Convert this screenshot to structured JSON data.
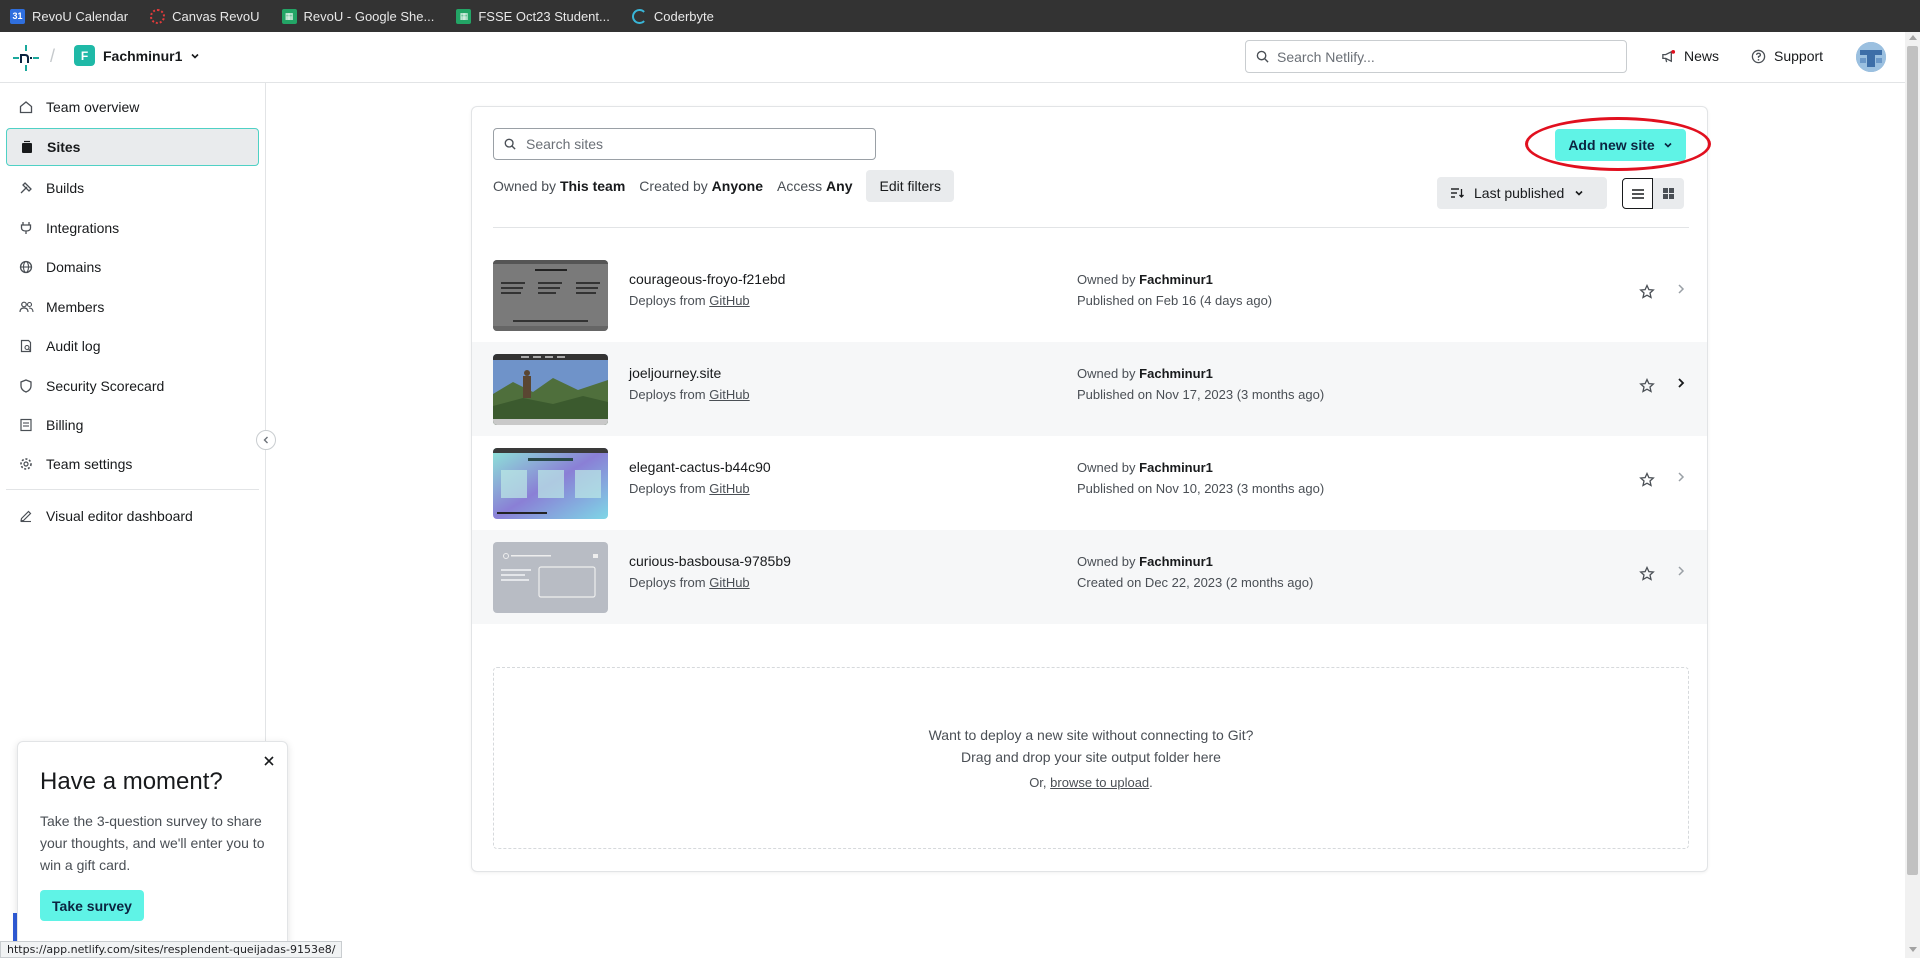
{
  "bookmarks": [
    {
      "label": "RevoU Calendar",
      "icon": "calendar-icon"
    },
    {
      "label": "Canvas RevoU",
      "icon": "canvas-icon"
    },
    {
      "label": "RevoU - Google She...",
      "icon": "sheets-icon"
    },
    {
      "label": "FSSE Oct23 Student...",
      "icon": "sheets-icon"
    },
    {
      "label": "Coderbyte",
      "icon": "coderbyte-icon"
    }
  ],
  "header": {
    "team_name": "Fachminur1",
    "team_initial": "F",
    "search_placeholder": "Search Netlify...",
    "news_label": "News",
    "support_label": "Support"
  },
  "sidebar": {
    "items": [
      {
        "label": "Team overview",
        "icon": "home-icon"
      },
      {
        "label": "Sites",
        "icon": "sites-icon"
      },
      {
        "label": "Builds",
        "icon": "builds-icon"
      },
      {
        "label": "Integrations",
        "icon": "plug-icon"
      },
      {
        "label": "Domains",
        "icon": "globe-icon"
      },
      {
        "label": "Members",
        "icon": "members-icon"
      },
      {
        "label": "Audit log",
        "icon": "audit-log-icon"
      },
      {
        "label": "Security Scorecard",
        "icon": "shield-icon"
      },
      {
        "label": "Billing",
        "icon": "billing-icon"
      },
      {
        "label": "Team settings",
        "icon": "gear-icon"
      },
      {
        "label": "Visual editor dashboard",
        "icon": "pencil-icon"
      }
    ]
  },
  "sites_panel": {
    "search_placeholder": "Search sites",
    "add_button": "Add new site",
    "filters": {
      "owned_by_label": "Owned by",
      "owned_by_value": "This team",
      "created_by_label": "Created by",
      "created_by_value": "Anyone",
      "access_label": "Access",
      "access_value": "Any",
      "edit_filters": "Edit filters"
    },
    "sort_label": "Last published",
    "sites": [
      {
        "name": "courageous-froyo-f21ebd",
        "deploy_prefix": "Deploys from",
        "deploy_source": "GitHub",
        "owner_prefix": "Owned by",
        "owner": "Fachminur1",
        "status": "Published on Feb 16 (4 days ago)"
      },
      {
        "name": "joeljourney.site",
        "deploy_prefix": "Deploys from",
        "deploy_source": "GitHub",
        "owner_prefix": "Owned by",
        "owner": "Fachminur1",
        "status": "Published on Nov 17, 2023 (3 months ago)"
      },
      {
        "name": "elegant-cactus-b44c90",
        "deploy_prefix": "Deploys from",
        "deploy_source": "GitHub",
        "owner_prefix": "Owned by",
        "owner": "Fachminur1",
        "status": "Published on Nov 10, 2023 (3 months ago)"
      },
      {
        "name": "curious-basbousa-9785b9",
        "deploy_prefix": "Deploys from",
        "deploy_source": "GitHub",
        "owner_prefix": "Owned by",
        "owner": "Fachminur1",
        "status": "Created on Dec 22, 2023 (2 months ago)"
      }
    ],
    "dropzone": {
      "line1": "Want to deploy a new site without connecting to Git?",
      "line2": "Drag and drop your site output folder here",
      "line3_prefix": "Or,",
      "line3_link": "browse to upload",
      "line3_suffix": "."
    }
  },
  "survey": {
    "title": "Have a moment?",
    "body": "Take the 3-question survey to share your thoughts, and we'll enter you to win a gift card.",
    "button": "Take survey"
  },
  "status_url": "https://app.netlify.com/sites/resplendent-queijadas-9153e8/",
  "colors": {
    "accent": "#5ff3e6",
    "active_border": "#4fd1c5",
    "annotation": "#e1101f",
    "bookmarks_bg": "#333333"
  }
}
